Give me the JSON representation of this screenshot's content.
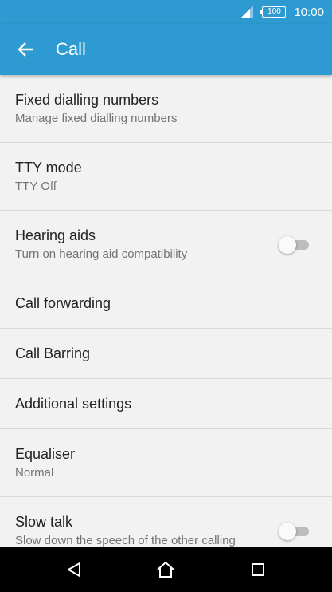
{
  "status_bar": {
    "battery_level": "100",
    "time": "10:00"
  },
  "app_bar": {
    "title": "Call",
    "back_icon": "arrow-left-icon"
  },
  "settings": [
    {
      "title": "Fixed dialling numbers",
      "subtitle": "Manage fixed dialling numbers"
    },
    {
      "title": "TTY mode",
      "subtitle": "TTY Off"
    },
    {
      "title": "Hearing aids",
      "subtitle": "Turn on hearing aid compatibility",
      "toggle_on": false
    },
    {
      "title": "Call forwarding"
    },
    {
      "title": "Call Barring"
    },
    {
      "title": "Additional settings"
    },
    {
      "title": "Equaliser",
      "subtitle": "Normal"
    },
    {
      "title": "Slow talk",
      "subtitle": "Slow down the speech of the other calling",
      "toggle_on": false
    }
  ],
  "nav_bar": {
    "back_icon": "triangle-back-icon",
    "home_icon": "home-icon",
    "recents_icon": "square-recents-icon"
  },
  "colors": {
    "primary": "#2d9ad1",
    "background": "#f2f2f2",
    "divider": "#d9d9d9",
    "text_primary": "#222222",
    "text_secondary": "#737373"
  }
}
